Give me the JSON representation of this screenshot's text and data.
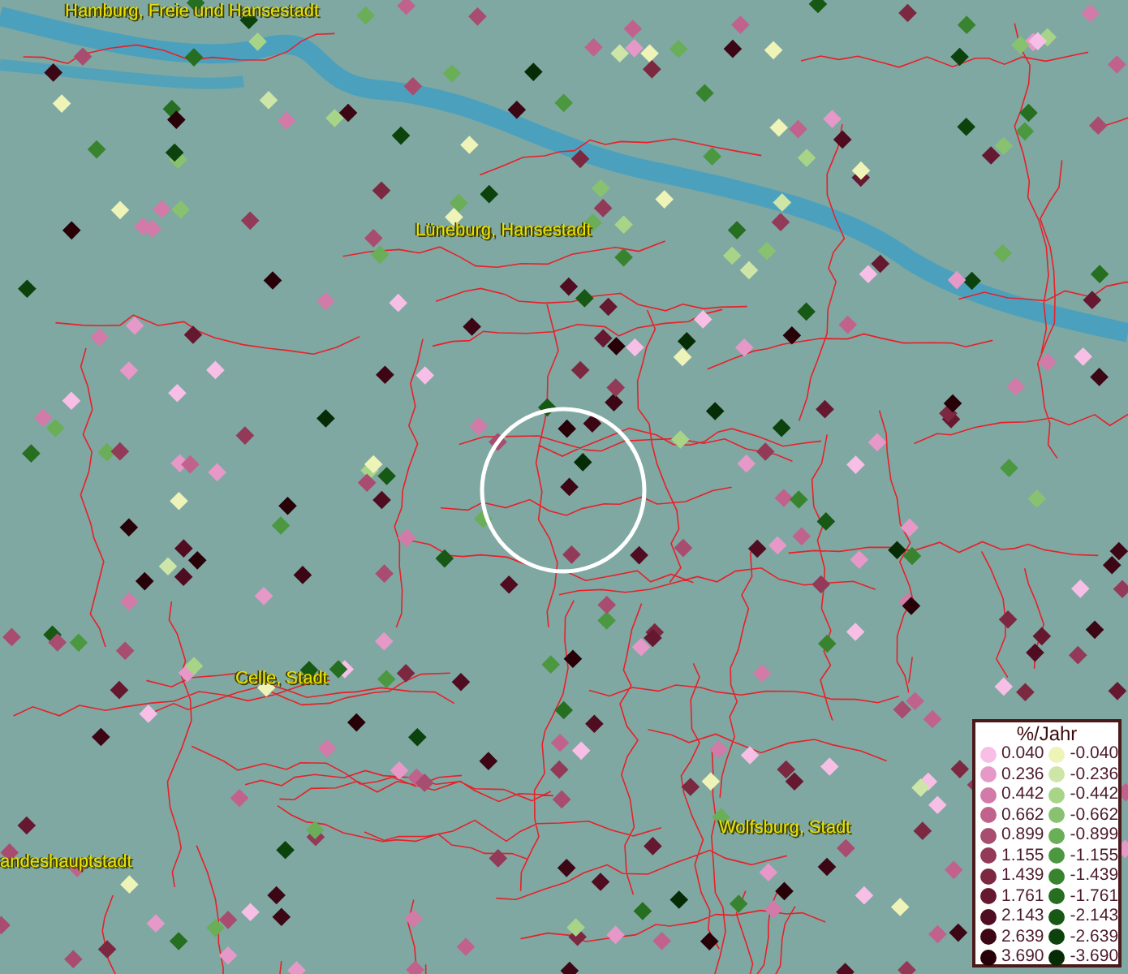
{
  "map": {
    "labels": [
      {
        "text": "Hamburg, Freie und Hansestadt"
      },
      {
        "text": "Lüneburg, Hansestadt"
      },
      {
        "text": "Celle, Stadt"
      },
      {
        "text": "andeshauptstadt"
      },
      {
        "text": "Wolfsburg, Stadt"
      }
    ]
  },
  "legend": {
    "title": "%/Jahr",
    "rows": [
      {
        "left": {
          "value": "0.040",
          "color": "#f7bfe6"
        },
        "right": {
          "value": "-0.040",
          "color": "#eef3b8"
        }
      },
      {
        "left": {
          "value": "0.236",
          "color": "#e699c8"
        },
        "right": {
          "value": "-0.236",
          "color": "#cde6a8"
        }
      },
      {
        "left": {
          "value": "0.442",
          "color": "#d27aa8"
        },
        "right": {
          "value": "-0.442",
          "color": "#a8d488"
        }
      },
      {
        "left": {
          "value": "0.662",
          "color": "#c0628c"
        },
        "right": {
          "value": "-0.662",
          "color": "#88c270"
        }
      },
      {
        "left": {
          "value": "0.899",
          "color": "#a84c70"
        },
        "right": {
          "value": "-0.899",
          "color": "#6aae58"
        }
      },
      {
        "left": {
          "value": "1.155",
          "color": "#923a58"
        },
        "right": {
          "value": "-1.155",
          "color": "#4c9840"
        }
      },
      {
        "left": {
          "value": "1.439",
          "color": "#7c2840"
        },
        "right": {
          "value": "-1.439",
          "color": "#38842e"
        }
      },
      {
        "left": {
          "value": "1.761",
          "color": "#661830"
        },
        "right": {
          "value": "-1.761",
          "color": "#266e20"
        }
      },
      {
        "left": {
          "value": "2.143",
          "color": "#500c20"
        },
        "right": {
          "value": "-2.143",
          "color": "#165814"
        }
      },
      {
        "left": {
          "value": "2.639",
          "color": "#3c0614"
        },
        "right": {
          "value": "-2.639",
          "color": "#0c420c"
        }
      },
      {
        "left": {
          "value": "3.690",
          "color": "#280008"
        },
        "right": {
          "value": "-3.690",
          "color": "#062c06"
        }
      }
    ]
  }
}
